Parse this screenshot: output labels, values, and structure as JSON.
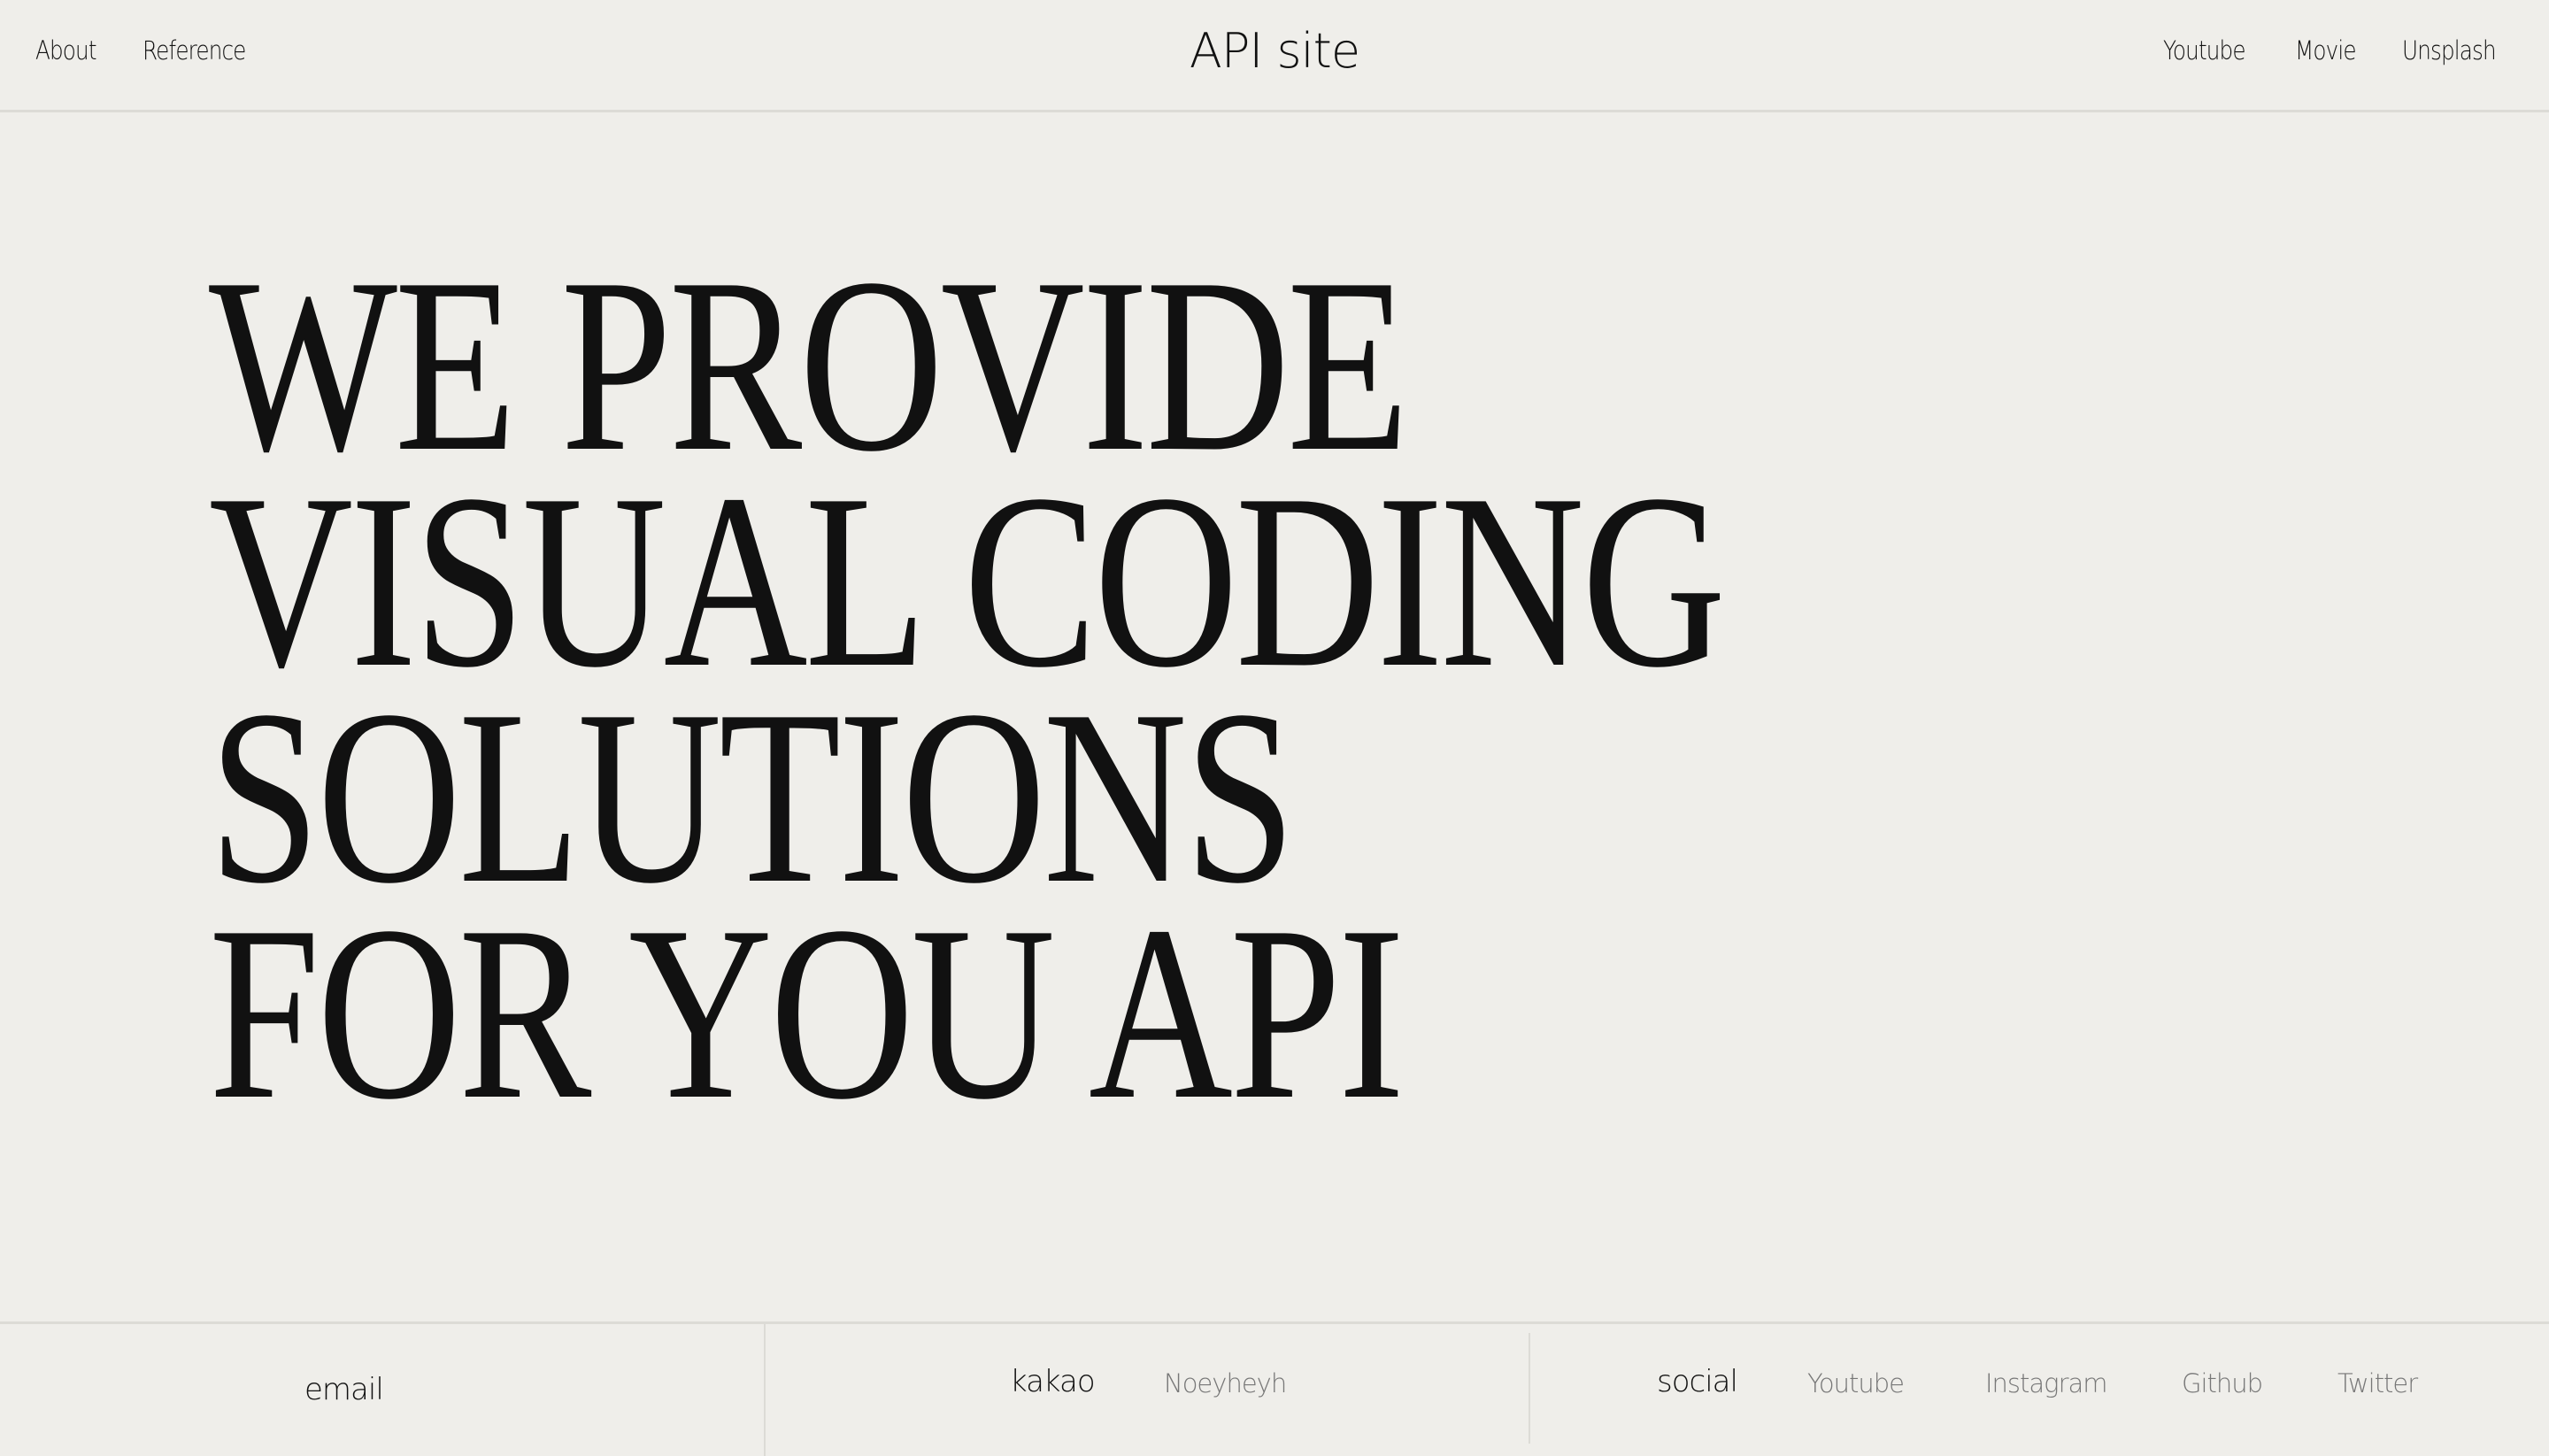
{
  "header": {
    "title": "API site",
    "left_nav": [
      "About",
      "Reference"
    ],
    "right_nav": [
      "Youtube",
      "Movie",
      "Unsplash"
    ]
  },
  "hero": {
    "lines": [
      "WE PROVIDE",
      "VISUAL CODING",
      "SOLUTIONS",
      "FOR YOU API"
    ]
  },
  "footer": {
    "email_label": "email",
    "kakao_label": "kakao",
    "kakao_id": "Noeyheyh",
    "social_label": "social",
    "social_links": [
      "Youtube",
      "Instagram",
      "Github",
      "Twitter"
    ]
  }
}
